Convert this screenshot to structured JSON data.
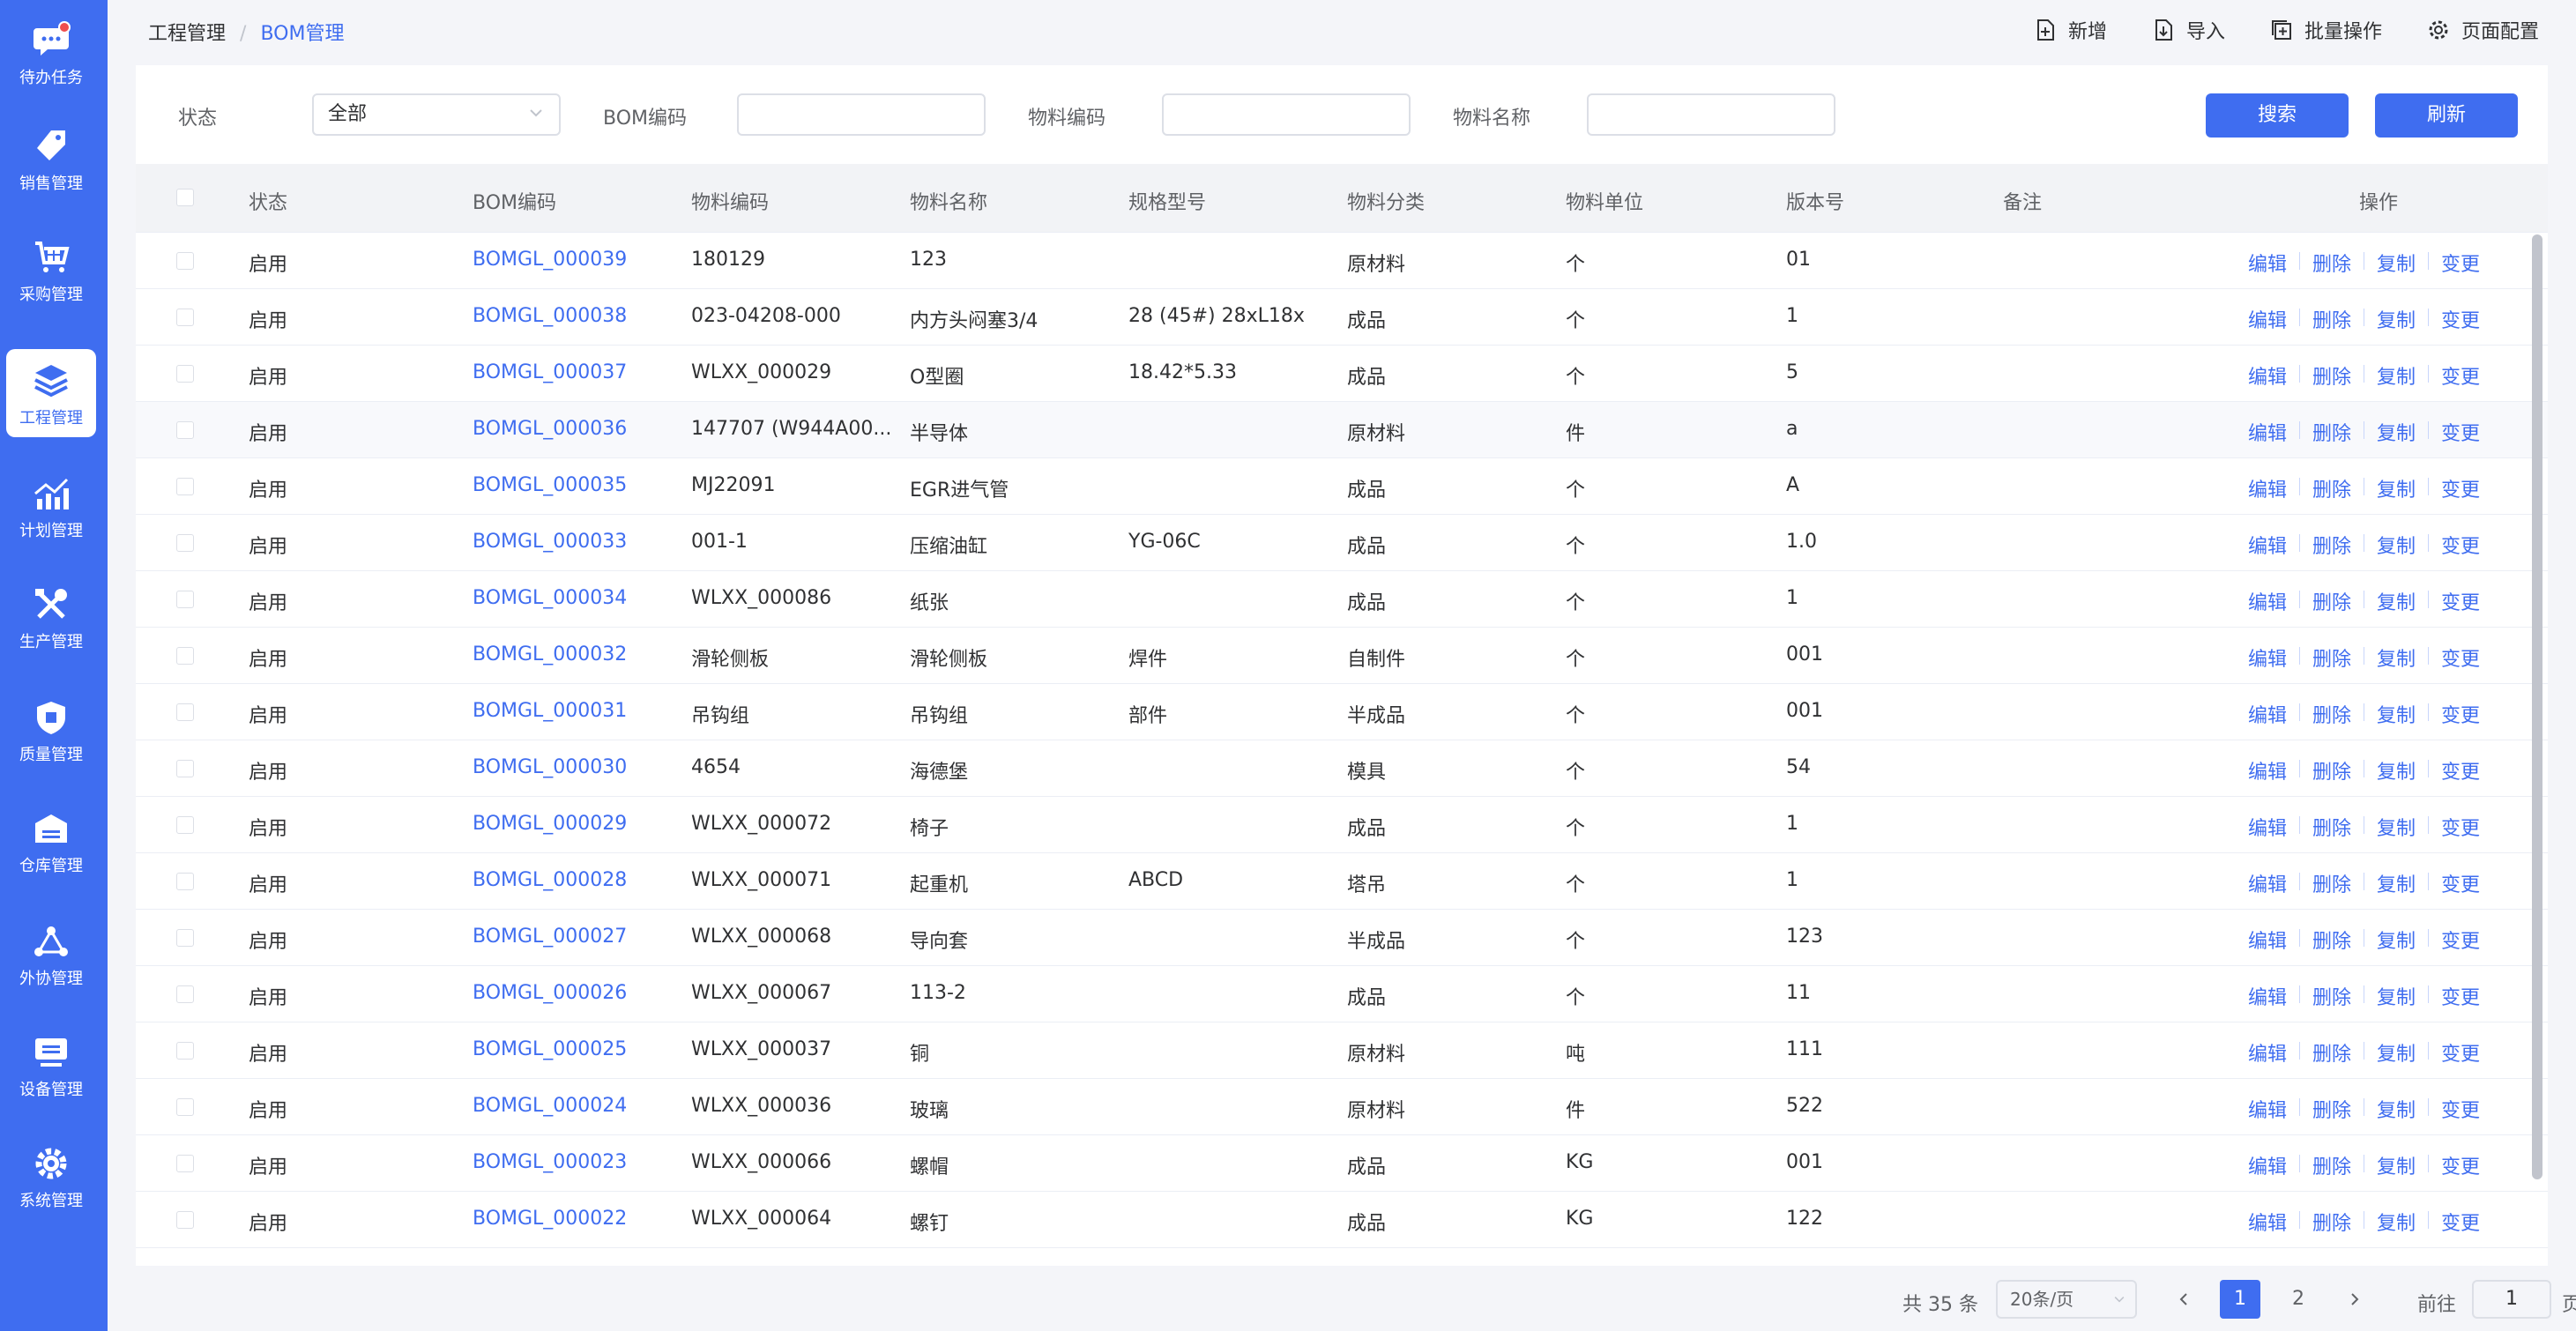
{
  "sidebar": {
    "items": [
      {
        "label": "待办任务",
        "icon": "chat-icon"
      },
      {
        "label": "销售管理",
        "icon": "tag-icon"
      },
      {
        "label": "采购管理",
        "icon": "cart-icon"
      },
      {
        "label": "工程管理",
        "icon": "layers-icon"
      },
      {
        "label": "计划管理",
        "icon": "chart-up-icon"
      },
      {
        "label": "生产管理",
        "icon": "tools-icon"
      },
      {
        "label": "质量管理",
        "icon": "shield-icon"
      },
      {
        "label": "仓库管理",
        "icon": "warehouse-icon"
      },
      {
        "label": "外协管理",
        "icon": "network-icon"
      },
      {
        "label": "设备管理",
        "icon": "monitor-icon"
      },
      {
        "label": "系统管理",
        "icon": "gear-icon"
      }
    ],
    "active_index": 3
  },
  "breadcrumb": {
    "parent": "工程管理",
    "separator": "/",
    "current": "BOM管理"
  },
  "top_actions": {
    "add": "新增",
    "import": "导入",
    "batch": "批量操作",
    "page_config": "页面配置"
  },
  "filter": {
    "status_label": "状态",
    "status_value": "全部",
    "bom_code_label": "BOM编码",
    "material_code_label": "物料编码",
    "material_name_label": "物料名称",
    "search_button": "搜索",
    "refresh_button": "刷新"
  },
  "table": {
    "headers": {
      "status": "状态",
      "bom_code": "BOM编码",
      "material_code": "物料编码",
      "material_name": "物料名称",
      "spec": "规格型号",
      "category": "物料分类",
      "unit": "物料单位",
      "version": "版本号",
      "remark": "备注",
      "actions": "操作"
    },
    "op_labels": [
      "编辑",
      "删除",
      "复制",
      "变更"
    ],
    "rows": [
      {
        "status": "启用",
        "bom_code": "BOMGL_000039",
        "material_code": "180129",
        "material_name": "123",
        "spec": "",
        "category": "原材料",
        "unit": "个",
        "version": "01"
      },
      {
        "status": "启用",
        "bom_code": "BOMGL_000038",
        "material_code": "023-04208-000",
        "material_name": "内方头闷塞3/4",
        "spec": "28 (45#) 28xL18x",
        "category": "成品",
        "unit": "个",
        "version": "1"
      },
      {
        "status": "启用",
        "bom_code": "BOMGL_000037",
        "material_code": "WLXX_000029",
        "material_name": "O型圈",
        "spec": "18.42*5.33",
        "category": "成品",
        "unit": "个",
        "version": "5"
      },
      {
        "status": "启用",
        "bom_code": "BOMGL_000036",
        "material_code": "147707 (W944A00...",
        "material_name": "半导体",
        "spec": "",
        "category": "原材料",
        "unit": "件",
        "version": "a"
      },
      {
        "status": "启用",
        "bom_code": "BOMGL_000035",
        "material_code": "MJ22091",
        "material_name": "EGR进气管",
        "spec": "",
        "category": "成品",
        "unit": "个",
        "version": "A"
      },
      {
        "status": "启用",
        "bom_code": "BOMGL_000033",
        "material_code": "001-1",
        "material_name": "压缩油缸",
        "spec": "YG-06C",
        "category": "成品",
        "unit": "个",
        "version": "1.0"
      },
      {
        "status": "启用",
        "bom_code": "BOMGL_000034",
        "material_code": "WLXX_000086",
        "material_name": "纸张",
        "spec": "",
        "category": "成品",
        "unit": "个",
        "version": "1"
      },
      {
        "status": "启用",
        "bom_code": "BOMGL_000032",
        "material_code": "滑轮侧板",
        "material_name": "滑轮侧板",
        "spec": "焊件",
        "category": "自制件",
        "unit": "个",
        "version": "001"
      },
      {
        "status": "启用",
        "bom_code": "BOMGL_000031",
        "material_code": "吊钩组",
        "material_name": "吊钩组",
        "spec": "部件",
        "category": "半成品",
        "unit": "个",
        "version": "001"
      },
      {
        "status": "启用",
        "bom_code": "BOMGL_000030",
        "material_code": "4654",
        "material_name": "海德堡",
        "spec": "",
        "category": "模具",
        "unit": "个",
        "version": "54"
      },
      {
        "status": "启用",
        "bom_code": "BOMGL_000029",
        "material_code": "WLXX_000072",
        "material_name": "椅子",
        "spec": "",
        "category": "成品",
        "unit": "个",
        "version": "1"
      },
      {
        "status": "启用",
        "bom_code": "BOMGL_000028",
        "material_code": "WLXX_000071",
        "material_name": "起重机",
        "spec": "ABCD",
        "category": "塔吊",
        "unit": "个",
        "version": "1"
      },
      {
        "status": "启用",
        "bom_code": "BOMGL_000027",
        "material_code": "WLXX_000068",
        "material_name": "导向套",
        "spec": "",
        "category": "半成品",
        "unit": "个",
        "version": "123"
      },
      {
        "status": "启用",
        "bom_code": "BOMGL_000026",
        "material_code": "WLXX_000067",
        "material_name": "113-2",
        "spec": "",
        "category": "成品",
        "unit": "个",
        "version": "11"
      },
      {
        "status": "启用",
        "bom_code": "BOMGL_000025",
        "material_code": "WLXX_000037",
        "material_name": "铜",
        "spec": "",
        "category": "原材料",
        "unit": "吨",
        "version": "111"
      },
      {
        "status": "启用",
        "bom_code": "BOMGL_000024",
        "material_code": "WLXX_000036",
        "material_name": "玻璃",
        "spec": "",
        "category": "原材料",
        "unit": "件",
        "version": "522"
      },
      {
        "status": "启用",
        "bom_code": "BOMGL_000023",
        "material_code": "WLXX_000066",
        "material_name": "螺帽",
        "spec": "",
        "category": "成品",
        "unit": "KG",
        "version": "001"
      },
      {
        "status": "启用",
        "bom_code": "BOMGL_000022",
        "material_code": "WLXX_000064",
        "material_name": "螺钉",
        "spec": "",
        "category": "成品",
        "unit": "KG",
        "version": "122"
      }
    ],
    "highlighted_row": 3
  },
  "pagination": {
    "total": "共 35 条",
    "page_size": "20条/页",
    "pages": [
      "1",
      "2"
    ],
    "current_page": "1",
    "goto_label": "前往",
    "goto_value": "1",
    "page_suffix": "页",
    "prev_icon": "chevron-left-icon",
    "next_icon": "chevron-right-icon"
  },
  "colors": {
    "primary": "#3f6df0",
    "sidebar_bg": "#3f6df0",
    "badge": "#f04e4e"
  }
}
